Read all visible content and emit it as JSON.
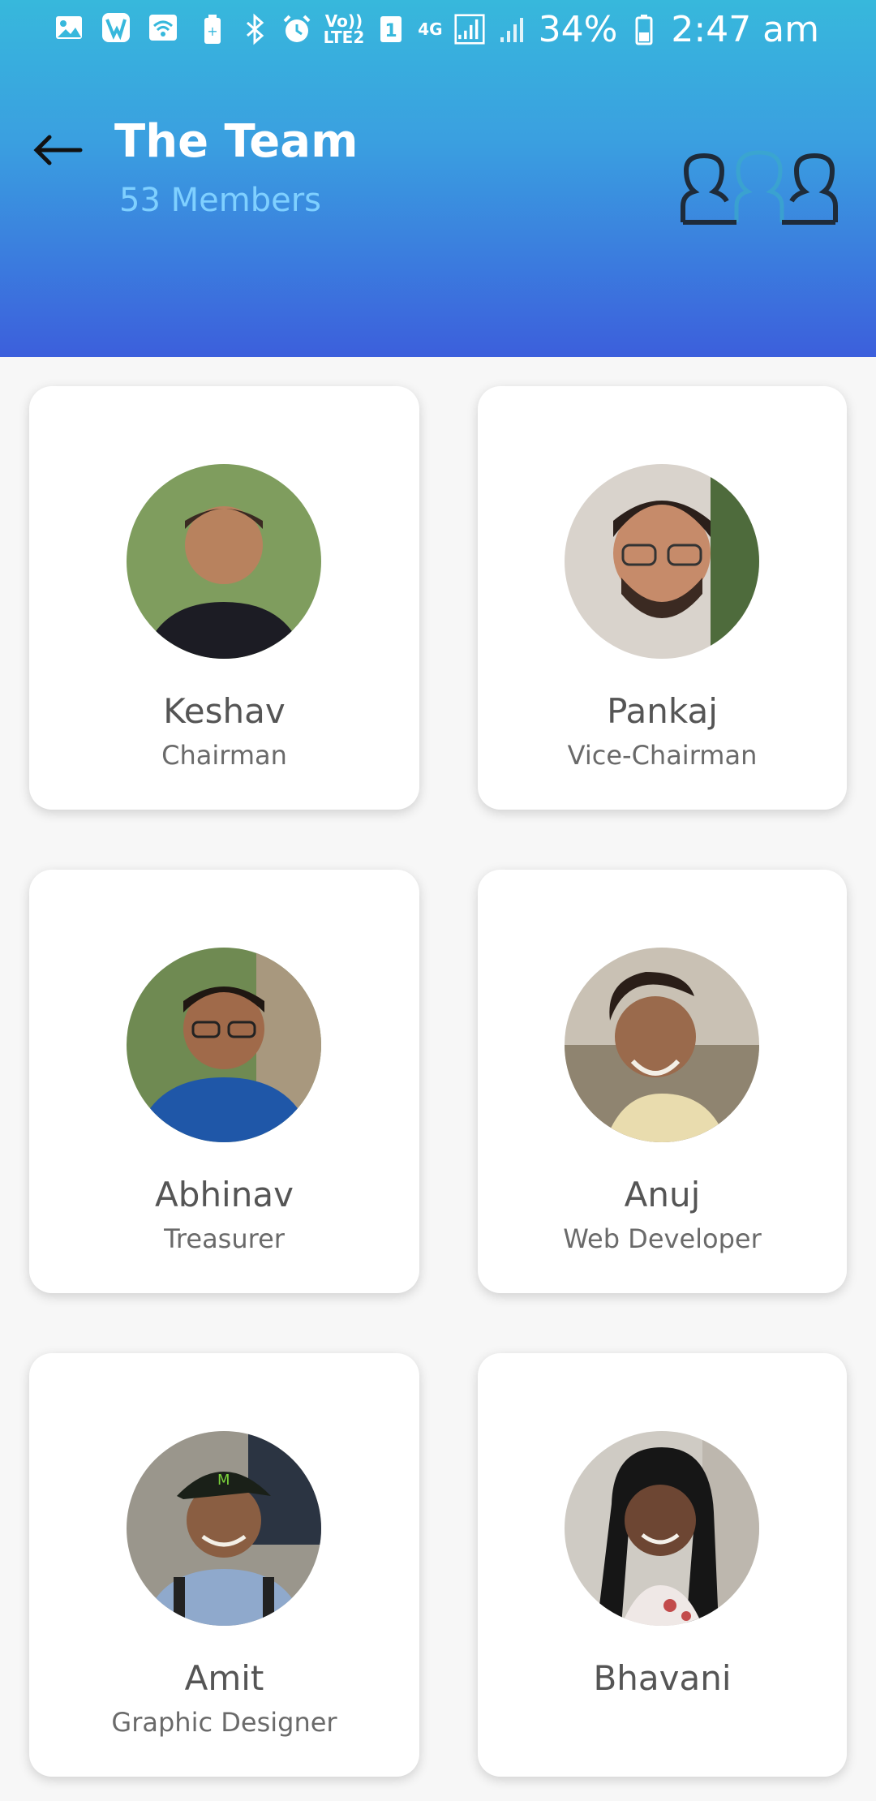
{
  "status_bar": {
    "volte": "Vo))\nLTE2",
    "sim": "1",
    "network": "4G",
    "battery": "34%",
    "time": "2:47 am"
  },
  "header": {
    "title": "The Team",
    "members": "53 Members"
  },
  "members": [
    {
      "name": "Keshav",
      "role": "Chairman",
      "avatar_color": "#6f8f56"
    },
    {
      "name": "Pankaj",
      "role": "Vice-Chairman",
      "avatar_color": "#8a6f5c"
    },
    {
      "name": "Abhinav",
      "role": "Treasurer",
      "avatar_color": "#1f57a8"
    },
    {
      "name": "Anuj",
      "role": "Web Developer",
      "avatar_color": "#9a8a78"
    },
    {
      "name": "Amit",
      "role": "Graphic Designer",
      "avatar_color": "#6d7a8a"
    },
    {
      "name": "Bhavani",
      "role": "",
      "avatar_color": "#b9b4ad"
    }
  ],
  "colors": {
    "header_top": "#37b8dc",
    "header_bottom": "#3c5fdc",
    "subtitle": "#7fd0ff"
  }
}
